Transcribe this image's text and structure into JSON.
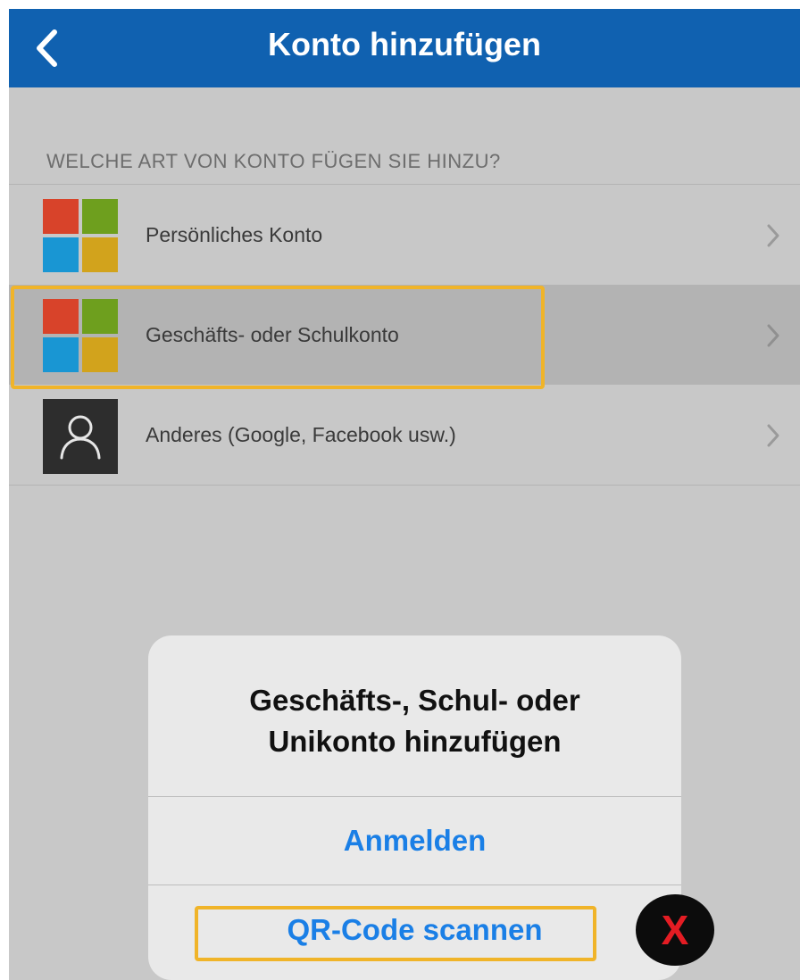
{
  "header": {
    "title": "Konto hinzufügen",
    "back_icon": "chevron-left-icon",
    "background": "#1061b0"
  },
  "section": {
    "label": "WELCHE ART VON KONTO FÜGEN SIE HINZU?"
  },
  "account_types": [
    {
      "label": "Persönliches Konto",
      "icon": "microsoft-logo-icon",
      "selected": false
    },
    {
      "label": "Geschäfts- oder Schulkonto",
      "icon": "microsoft-logo-icon",
      "selected": true
    },
    {
      "label": "Anderes (Google, Facebook usw.)",
      "icon": "person-icon",
      "selected": false
    }
  ],
  "dialog": {
    "title_line1": "Geschäfts-, Schul- oder",
    "title_line2": "Unikonto hinzufügen",
    "sign_in_label": "Anmelden",
    "scan_qr_label": "QR-Code scannen",
    "button_color": "#1a7fe6"
  },
  "annotation": {
    "x_label": "X",
    "highlight_color": "#f0b429",
    "x_color": "#e41c23"
  },
  "ms_logo_colors": [
    "#f25022",
    "#7fba00",
    "#00a4ef",
    "#ffb900"
  ]
}
